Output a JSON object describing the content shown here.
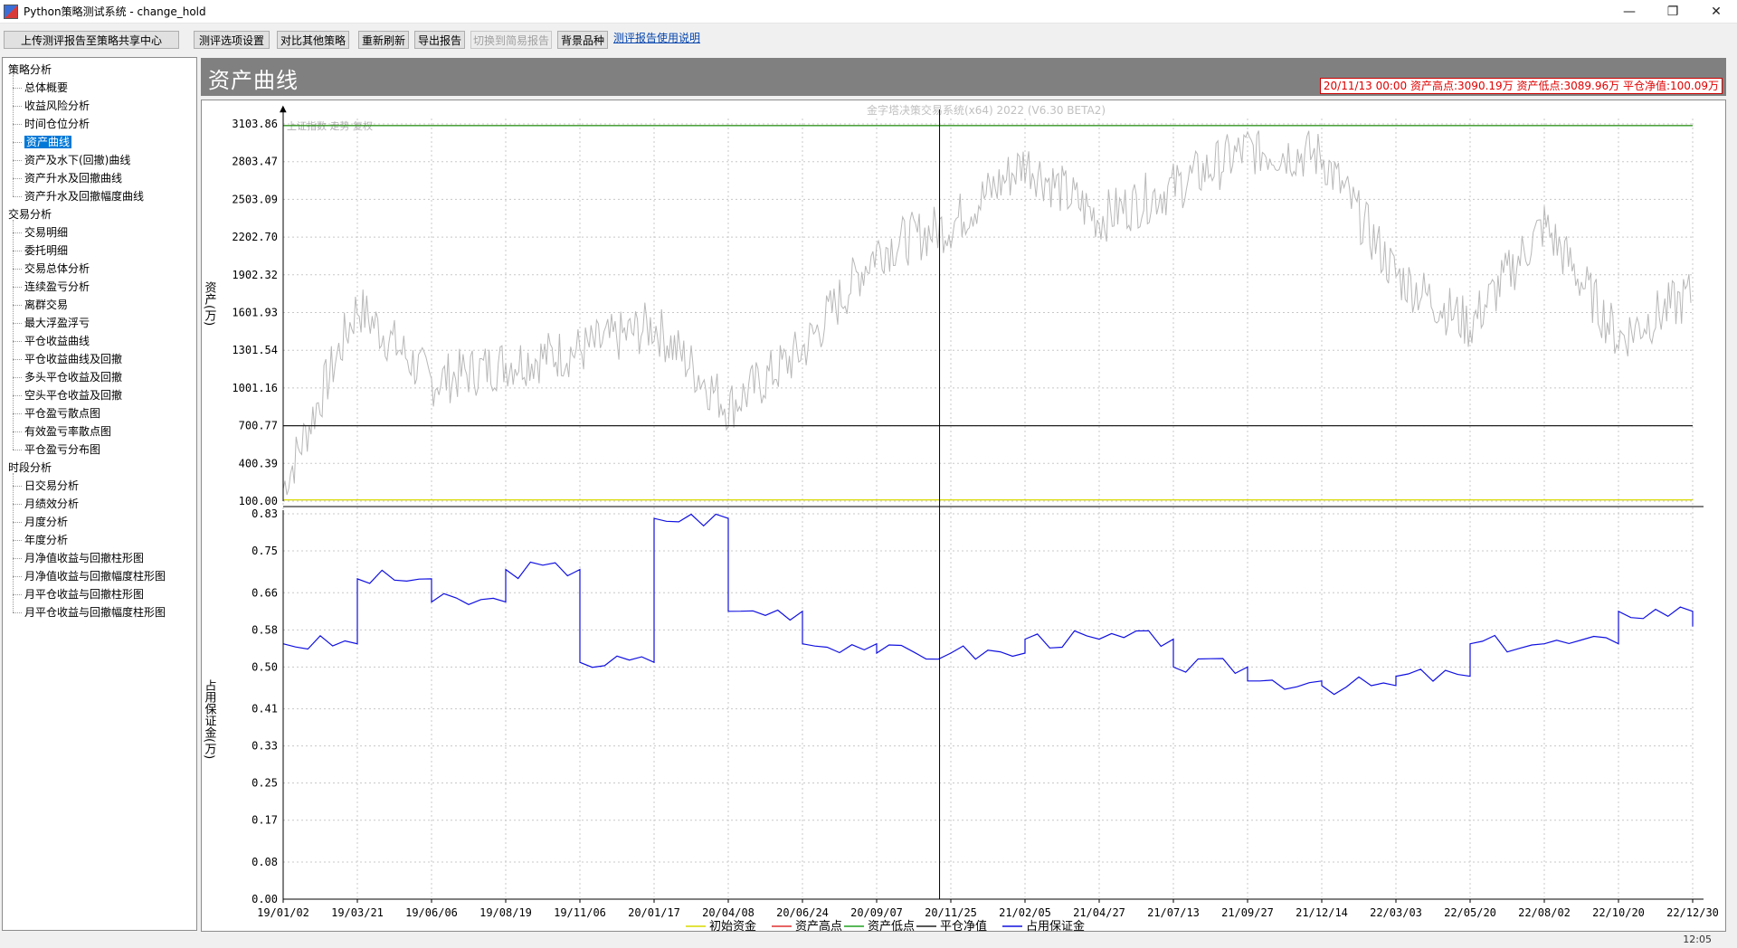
{
  "window": {
    "title": "Python策略测试系统 - change_hold",
    "min_glyph": "—",
    "max_glyph": "❐",
    "close_glyph": "✕"
  },
  "toolbar": {
    "upload": "上传测评报告至策略共享中心",
    "options": "测评选项设置",
    "compare": "对比其他策略",
    "refresh": "重新刷新",
    "export": "导出报告",
    "switch_simple": "切换到简易报告",
    "background": "背景品种",
    "help_link": "测评报告使用说明"
  },
  "tree": {
    "groups": [
      {
        "label": "策略分析",
        "items": [
          "总体概要",
          "收益风险分析",
          "时间仓位分析",
          "资产曲线",
          "资产及水下(回撤)曲线",
          "资产升水及回撤曲线",
          "资产升水及回撤幅度曲线"
        ]
      },
      {
        "label": "交易分析",
        "items": [
          "交易明细",
          "委托明细",
          "交易总体分析",
          "连续盈亏分析",
          "离群交易",
          "最大浮盈浮亏",
          "平仓收益曲线",
          "平仓收益曲线及回撤",
          "多头平仓收益及回撤",
          "空头平仓收益及回撤",
          "平仓盈亏散点图",
          "有效盈亏率散点图",
          "平仓盈亏分布图"
        ]
      },
      {
        "label": "时段分析",
        "items": [
          "日交易分析",
          "月绩效分析",
          "月度分析",
          "年度分析",
          "月净值收益与回撤柱形图",
          "月净值收益与回撤幅度柱形图",
          "月平仓收益与回撤柱形图",
          "月平仓收益与回撤幅度柱形图"
        ]
      }
    ],
    "selected": "资产曲线"
  },
  "panel": {
    "title": "资产曲线",
    "info": "20/11/13 00:00  资产高点:3090.19万  资产低点:3089.96万  平仓净值:100.09万"
  },
  "status": {
    "text": "12:05"
  },
  "colors": {
    "initial": "#d8d800",
    "high": "#e03030",
    "low": "#20a020",
    "closed": "#202020",
    "margin": "#1010e0",
    "bg_index": "#b8b8b8"
  },
  "chart_data": [
    {
      "type": "line",
      "watermark": "金字塔决策交易系统(x64) 2022 (V6.30 BETA2)",
      "background_label": "上证指数  走势  复权",
      "ylabel": "资产(万)",
      "y_ticks": [
        "3103.86",
        "2803.47",
        "2503.09",
        "2202.70",
        "1902.32",
        "1601.93",
        "1301.54",
        "1001.16",
        "700.77",
        "400.39",
        "100.00"
      ],
      "ylim": [
        100.0,
        3103.86
      ],
      "x_ticks": [
        "19/01/02",
        "19/03/21",
        "19/06/06",
        "19/08/19",
        "19/11/06",
        "20/01/17",
        "20/04/08",
        "20/06/24",
        "20/09/07",
        "20/11/25",
        "21/02/05",
        "21/04/27",
        "21/07/13",
        "21/09/27",
        "21/12/14",
        "22/03/03",
        "22/05/20",
        "22/08/02",
        "22/10/20",
        "22/12/30"
      ],
      "grid": true,
      "series": [
        {
          "name": "初始资金",
          "x": [
            "19/01/02",
            "22/12/30"
          ],
          "values": [
            110,
            110
          ]
        },
        {
          "name": "资产高点",
          "x": [
            "19/01/02",
            "20/11/13",
            "22/12/30"
          ],
          "values": [
            3090.19,
            3090.19,
            3090.19
          ]
        },
        {
          "name": "资产低点",
          "x": [
            "19/01/02",
            "20/11/13",
            "22/12/30"
          ],
          "values": [
            3089.96,
            3089.96,
            3089.96
          ]
        },
        {
          "name": "平仓净值",
          "x": [
            "19/01/02",
            "22/12/30"
          ],
          "values": [
            700.77,
            700.77
          ]
        }
      ],
      "background_series": {
        "x": [
          "19/01/02",
          "19/03/21",
          "19/06/06",
          "19/08/19",
          "19/11/06",
          "20/01/17",
          "20/04/08",
          "20/06/24",
          "20/09/07",
          "20/11/25",
          "21/02/05",
          "21/04/27",
          "21/07/13",
          "21/09/27",
          "21/12/14",
          "22/03/03",
          "22/05/20",
          "22/08/02",
          "22/10/20",
          "22/12/30"
        ],
        "values": [
          200,
          1650,
          1050,
          1200,
          1300,
          1500,
          850,
          1300,
          2100,
          2300,
          2800,
          2350,
          2600,
          2900,
          2850,
          1900,
          1500,
          2300,
          1400,
          1750
        ]
      }
    },
    {
      "type": "line",
      "ylabel": "占用保证金(万)",
      "y_ticks": [
        "0.83",
        "0.75",
        "0.66",
        "0.58",
        "0.50",
        "0.41",
        "0.33",
        "0.25",
        "0.17",
        "0.08",
        "0.00"
      ],
      "ylim": [
        0.0,
        0.83
      ],
      "grid": true,
      "series": [
        {
          "name": "占用保证金",
          "x": [
            "19/01/02",
            "19/03/21",
            "19/06/06",
            "19/08/19",
            "19/11/06",
            "20/01/17",
            "20/04/08",
            "20/06/24",
            "20/09/07",
            "20/11/25",
            "21/02/05",
            "21/04/27",
            "21/07/13",
            "21/09/27",
            "21/12/14",
            "22/03/03",
            "22/05/20",
            "22/08/02",
            "22/10/20",
            "22/12/30"
          ],
          "values": [
            0.55,
            0.69,
            0.64,
            0.71,
            0.51,
            0.82,
            0.62,
            0.55,
            0.53,
            0.53,
            0.56,
            0.56,
            0.5,
            0.47,
            0.46,
            0.48,
            0.55,
            0.55,
            0.62,
            0.6
          ]
        }
      ]
    }
  ],
  "legend": [
    "初始资金",
    "资产高点",
    "资产低点",
    "平仓净值",
    "占用保证金"
  ]
}
